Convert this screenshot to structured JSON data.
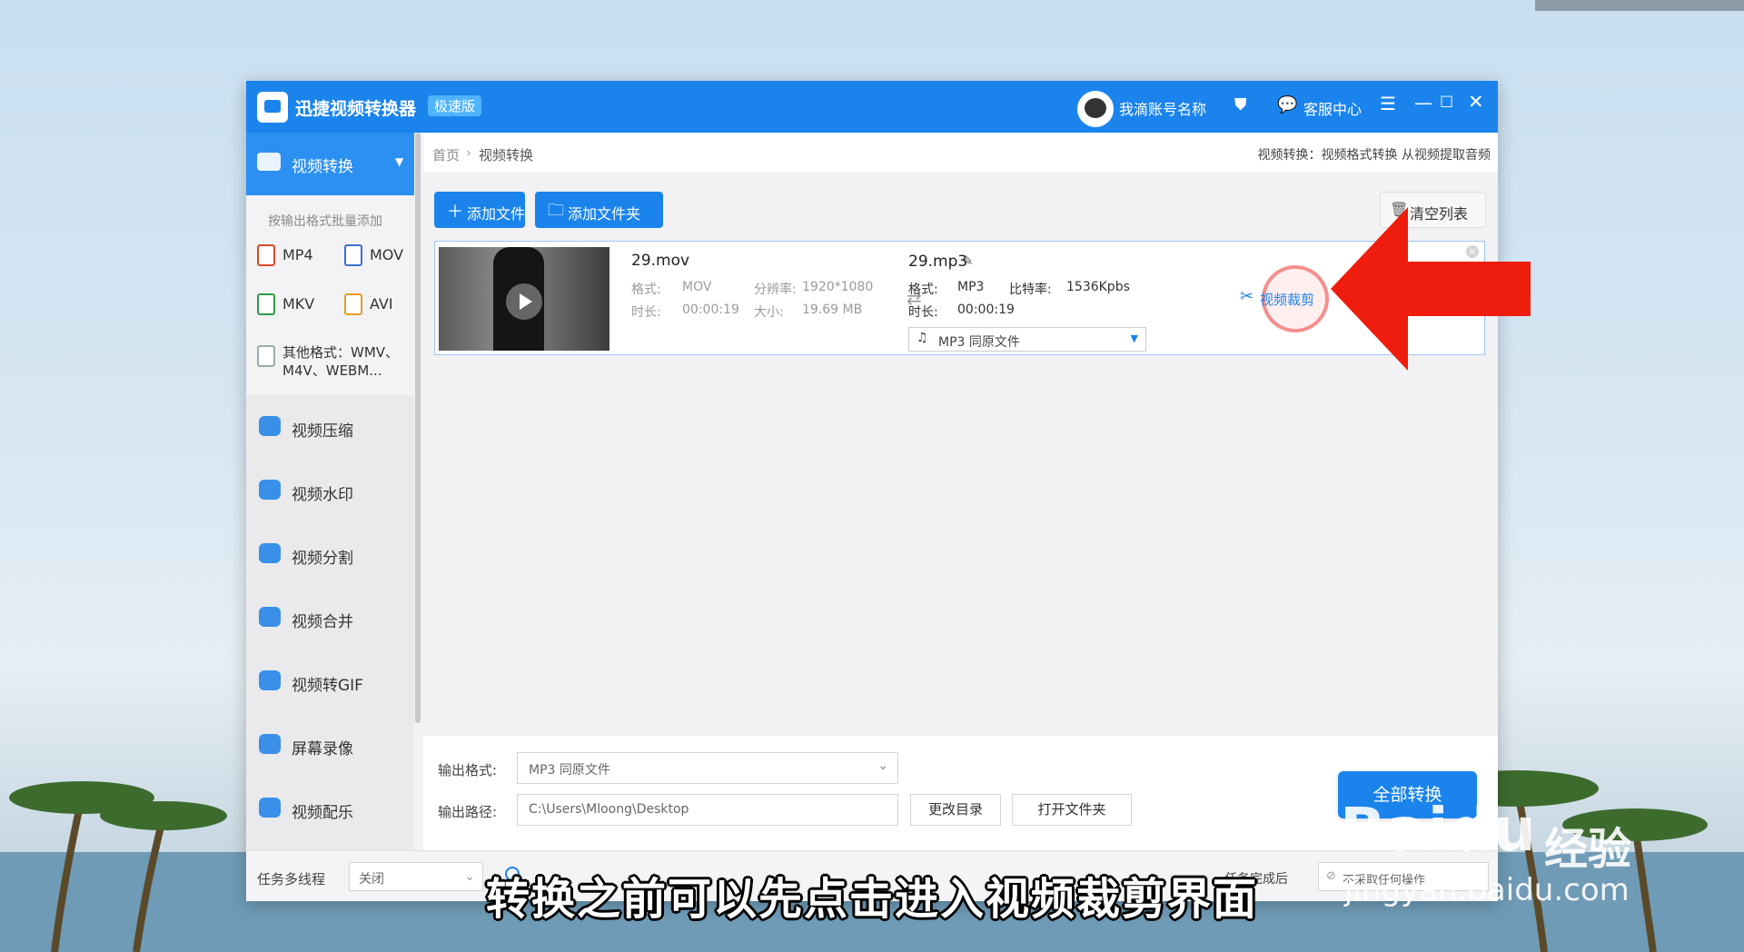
{
  "app": {
    "title": "迅捷视频转换器",
    "edition_badge": "极速版",
    "account_name": "我滴账号名称",
    "service_label": "客服中心",
    "brand_color": "#1a84ec"
  },
  "sidebar": {
    "active": {
      "label": "视频转换",
      "icon": "video-convert-icon"
    },
    "hint": "按输出格式批量添加",
    "formats": [
      {
        "label": "MP4",
        "icon": "mp4-file-icon"
      },
      {
        "label": "MOV",
        "icon": "mov-file-icon"
      },
      {
        "label": "MKV",
        "icon": "mkv-file-icon"
      },
      {
        "label": "AVI",
        "icon": "avi-file-icon"
      }
    ],
    "other_formats": {
      "line1": "其他格式：WMV、",
      "line2": "M4V、WEBM..."
    },
    "items": [
      {
        "label": "视频压缩",
        "icon": "compress-icon"
      },
      {
        "label": "视频水印",
        "icon": "watermark-icon"
      },
      {
        "label": "视频分割",
        "icon": "split-icon"
      },
      {
        "label": "视频合并",
        "icon": "merge-icon"
      },
      {
        "label": "视频转GIF",
        "icon": "gif-icon"
      },
      {
        "label": "屏幕录像",
        "icon": "screen-record-icon"
      },
      {
        "label": "视频配乐",
        "icon": "music-icon"
      }
    ]
  },
  "breadcrumb": {
    "home": "首页",
    "separator": "›",
    "current": "视频转换",
    "description": "视频转换：视频格式转换 从视频提取音频"
  },
  "toolbar": {
    "add_file": "添加文件",
    "add_folder": "添加文件夹",
    "clear_list": "清空列表"
  },
  "file": {
    "source": {
      "name": "29.mov",
      "format_label": "格式:",
      "format": "MOV",
      "resolution_label": "分辨率:",
      "resolution": "1920*1080",
      "duration_label": "时长:",
      "duration": "00:00:19",
      "size_label": "大小:",
      "size": "19.69 MB"
    },
    "output": {
      "name": "29.mp3",
      "format_label": "格式:",
      "format": "MP3",
      "bitrate_label": "比特率:",
      "bitrate": "1536Kpbs",
      "duration_label": "时长:",
      "duration": "00:00:19",
      "preset": "MP3   同原文件"
    },
    "cut_label": "视频裁剪"
  },
  "output_settings": {
    "format_label": "输出格式:",
    "format_value": "MP3   同原文件",
    "path_label": "输出路径:",
    "path_value": "C:\\Users\\Mloong\\Desktop",
    "change_dir": "更改目录",
    "open_folder": "打开文件夹",
    "convert_all": "全部转换"
  },
  "statusbar": {
    "multithread_label": "任务多线程",
    "multithread_value": "关闭",
    "on_complete_label": "任务完成后",
    "on_complete_value": "不采取任何操作"
  },
  "overlay": {
    "subtitle": "转换之前可以先点击进入视频裁剪界面",
    "watermark_brand": "Baidu",
    "watermark_cn": "经验",
    "watermark_url": "jingyan.baidu.com",
    "arrow_color": "#ee1d0e"
  }
}
